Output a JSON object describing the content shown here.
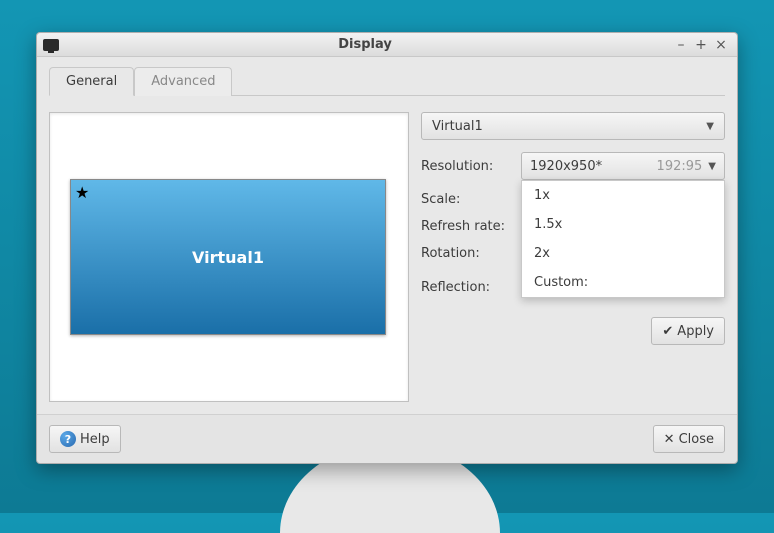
{
  "window": {
    "title": "Display",
    "minimize": "–",
    "maximize": "+",
    "close": "×"
  },
  "tabs": {
    "general": "General",
    "advanced": "Advanced"
  },
  "preview": {
    "monitor_name": "Virtual1",
    "star": "★"
  },
  "display_selector": {
    "value": "Virtual1"
  },
  "settings": {
    "resolution": {
      "label": "Resolution:",
      "value": "1920x950*",
      "ratio": "192:95"
    },
    "scale": {
      "label": "Scale:"
    },
    "refresh": {
      "label": "Refresh rate:"
    },
    "rotation": {
      "label": "Rotation:"
    },
    "reflection": {
      "label": "Reflection:"
    }
  },
  "scale_menu": {
    "options": [
      "1x",
      "1.5x",
      "2x",
      "Custom:"
    ]
  },
  "buttons": {
    "apply": "Apply",
    "help": "Help",
    "close": "Close"
  }
}
